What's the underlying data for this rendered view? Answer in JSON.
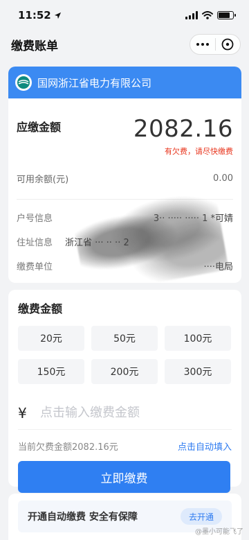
{
  "status_bar": {
    "time": "11:52"
  },
  "nav": {
    "title": "缴费账单"
  },
  "bill": {
    "company": "国网浙江省电力有限公司",
    "amount_label": "应缴金额",
    "amount_value": "2082.16",
    "overdue_notice": "有欠费，请尽快缴费",
    "balance_label": "可用余额(元)",
    "balance_value": "0.00",
    "details": [
      {
        "label": "户号信息",
        "value": "3·· ····· ····· 1 *可婧"
      },
      {
        "label": "住址信息",
        "value": "浙江省 ··· ·· ·· 2"
      },
      {
        "label": "缴费单位",
        "value": "····电局"
      }
    ]
  },
  "pay": {
    "title": "缴费金额",
    "options": [
      "20元",
      "50元",
      "100元",
      "150元",
      "200元",
      "300元"
    ],
    "currency_symbol": "¥",
    "input_placeholder": "点击输入缴费金额",
    "current_due_text": "当前欠费金额2082.16元",
    "autofill_label": "点击自动填入",
    "pay_button": "立即缴费"
  },
  "auto_pay": {
    "text": "开通自动缴费 安全有保障",
    "button": "去开通"
  },
  "watermark": "@墨小可能飞了",
  "colors": {
    "primary": "#2f7ff2",
    "company_bar": "#3b8af2",
    "warning": "#e8361e"
  }
}
